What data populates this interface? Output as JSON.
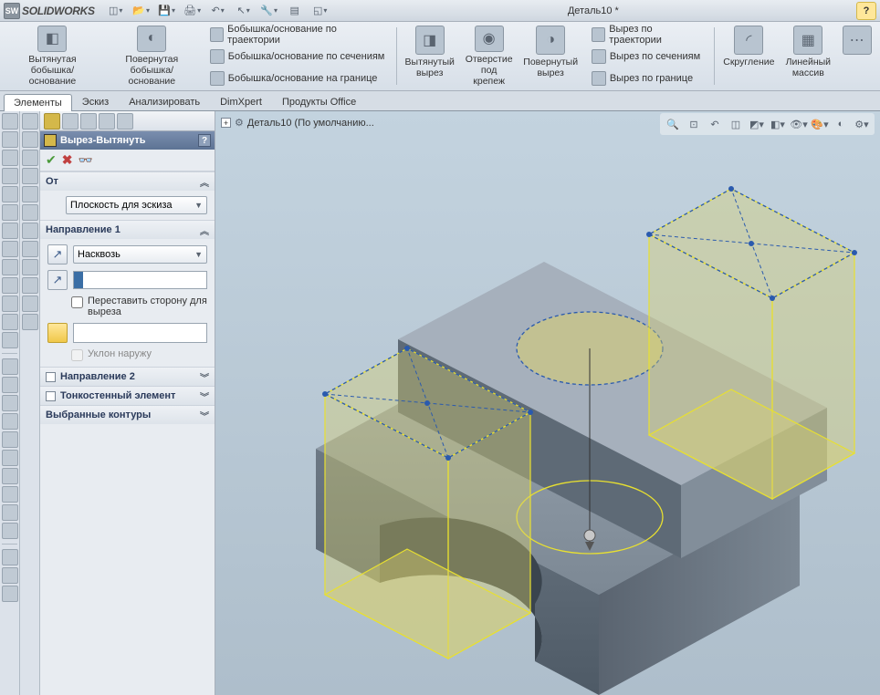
{
  "app": {
    "logo_text": "SOLIDWORKS"
  },
  "title": "Деталь10 *",
  "ribbon": {
    "extruded_boss": "Вытянутая\nбобышка/основание",
    "revolved_boss": "Повернутая\nбобышка/основание",
    "swept_boss": "Бобышка/основание по траектории",
    "lofted_boss": "Бобышка/основание по сечениям",
    "boundary_boss": "Бобышка/основание на границе",
    "extruded_cut": "Вытянутый\nвырез",
    "hole_wizard": "Отверстие\nпод\nкрепеж",
    "revolved_cut": "Повернутый\nвырез",
    "swept_cut": "Вырез по траектории",
    "lofted_cut": "Вырез по сечениям",
    "boundary_cut": "Вырез по границе",
    "fillet": "Скругление",
    "linear_pattern": "Линейный\nмассив"
  },
  "tabs": {
    "features": "Элементы",
    "sketch": "Эскиз",
    "evaluate": "Анализировать",
    "dimxpert": "DimXpert",
    "office": "Продукты Office"
  },
  "tree_flyout": "Деталь10  (По умолчанию...",
  "prop": {
    "title": "Вырез-Вытянуть",
    "from_section": "От",
    "from_value": "Плоскость для эскиза",
    "dir1_section": "Направление 1",
    "end_condition": "Насквозь",
    "depth_value": "",
    "flip_side": "Переставить сторону для выреза",
    "draft_outward": "Уклон наружу",
    "dir2_section": "Направление 2",
    "thin_section": "Тонкостенный элемент",
    "contours_section": "Выбранные контуры"
  }
}
